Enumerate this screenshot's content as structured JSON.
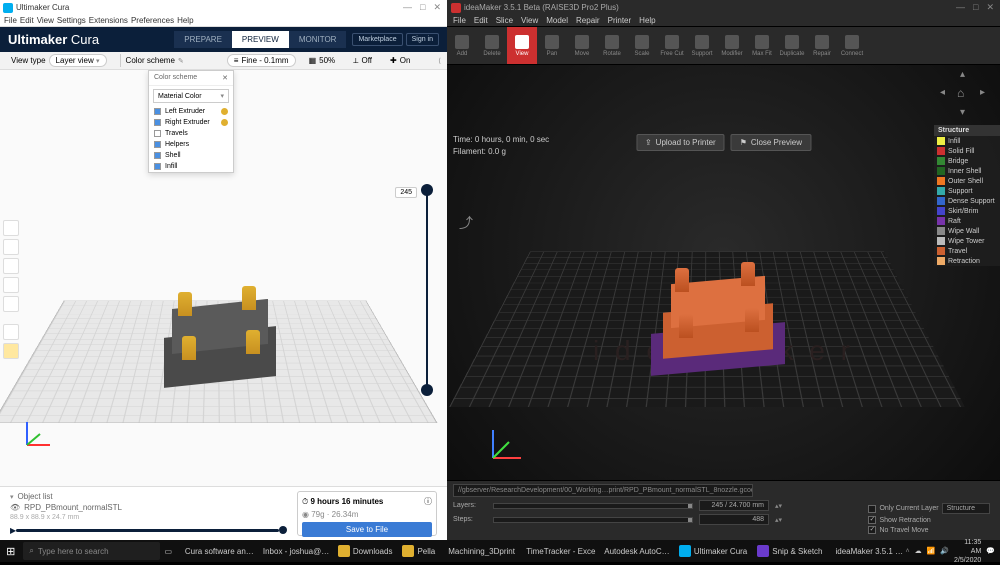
{
  "left": {
    "window_title": "Ultimaker Cura",
    "menu": [
      "File",
      "Edit",
      "View",
      "Settings",
      "Extensions",
      "Preferences",
      "Help"
    ],
    "brand_main": "Ultimaker",
    "brand_sub": "Cura",
    "tabs": {
      "prepare": "PREPARE",
      "preview": "PREVIEW",
      "monitor": "MONITOR"
    },
    "marketplace": "Marketplace",
    "signin": "Sign in",
    "optbar": {
      "viewtype_label": "View type",
      "viewtype_value": "Layer view",
      "scheme_label": "Color scheme",
      "profile": "Fine - 0.1mm",
      "infill": "50%",
      "support": "Off",
      "adhesion": "On"
    },
    "scheme_panel": {
      "header": "Color scheme",
      "dropdown": "Material Color",
      "rows": [
        {
          "label": "Left Extruder",
          "color": "#e0b030",
          "checked": true
        },
        {
          "label": "Right Extruder",
          "color": "#e0b030",
          "checked": true
        },
        {
          "label": "Travels",
          "checked": false
        },
        {
          "label": "Helpers",
          "checked": true
        },
        {
          "label": "Shell",
          "checked": true
        },
        {
          "label": "Infill",
          "checked": true
        }
      ]
    },
    "layer_slider_value": "245",
    "object_list": {
      "header": "Object list",
      "item": "RPD_PBmount_normalSTL",
      "dims": "88.9 x 88.9 x 24.7 mm"
    },
    "estimate": {
      "time": "9 hours 16 minutes",
      "material": "79g · 26.34m"
    },
    "save_btn": "Save to File"
  },
  "right": {
    "window_title": "ideaMaker 3.5.1 Beta (RAISE3D Pro2 Plus)",
    "menu": [
      "File",
      "Edit",
      "Slice",
      "View",
      "Model",
      "Repair",
      "Printer",
      "Help"
    ],
    "tools": [
      "Add",
      "Delete",
      "View",
      "Pan",
      "Move",
      "Rotate",
      "Scale",
      "Free Cut",
      "Support",
      "Modifier",
      "Max Fit",
      "Duplicate",
      "Repair",
      "Connect"
    ],
    "info": {
      "time": "Time: 0 hours, 0 min, 0 sec",
      "filament": "Filament: 0.0 g"
    },
    "actions": {
      "upload": "Upload to Printer",
      "close": "Close Preview"
    },
    "legend": {
      "header": "Structure",
      "rows": [
        {
          "label": "Infill",
          "color": "#eeee44"
        },
        {
          "label": "Solid Fill",
          "color": "#cc3030"
        },
        {
          "label": "Bridge",
          "color": "#338833"
        },
        {
          "label": "Inner Shell",
          "color": "#226622"
        },
        {
          "label": "Outer Shell",
          "color": "#ee7722"
        },
        {
          "label": "Support",
          "color": "#33aaaa"
        },
        {
          "label": "Dense Support",
          "color": "#3366cc"
        },
        {
          "label": "Skirt/Brim",
          "color": "#4444cc"
        },
        {
          "label": "Raft",
          "color": "#7733aa"
        },
        {
          "label": "Wipe Wall",
          "color": "#888888"
        },
        {
          "label": "Wipe Tower",
          "color": "#bbbbbb"
        },
        {
          "label": "Travel",
          "color": "#cc6030"
        },
        {
          "label": "Retraction",
          "color": "#eeaa66"
        }
      ]
    },
    "bottom": {
      "path": "//gbserver/ResearchDevelopment/00_Working…print/RPD_PBmount_normalSTL_8nozzle.gcode",
      "layers_label": "Layers:",
      "layers_value": "245 / 24.700 mm",
      "steps_label": "Steps:",
      "steps_value": "488",
      "only_current": "Only Current Layer",
      "show_retraction": "Show Retraction",
      "no_travel": "No Travel Move",
      "structure_dd": "Structure"
    }
  },
  "taskbar": {
    "search_placeholder": "Type here to search",
    "apps": [
      {
        "label": "Cura software an…",
        "color": "#00aeef"
      },
      {
        "label": "Inbox - joshua@…",
        "color": "#0078d4"
      },
      {
        "label": "Downloads",
        "color": "#e0b030"
      },
      {
        "label": "Pella",
        "color": "#e0b030"
      },
      {
        "label": "Machining_3Dprint",
        "color": "#0078d4"
      },
      {
        "label": "TimeTracker - Excel",
        "color": "#107c41"
      },
      {
        "label": "Autodesk AutoC…",
        "color": "#cc3030"
      },
      {
        "label": "Ultimaker Cura",
        "color": "#00aeef"
      },
      {
        "label": "Snip & Sketch",
        "color": "#6a3acc"
      },
      {
        "label": "ideaMaker 3.5.1 …",
        "color": "#cc3030"
      }
    ],
    "time": "11:35 AM",
    "date": "2/5/2020"
  }
}
